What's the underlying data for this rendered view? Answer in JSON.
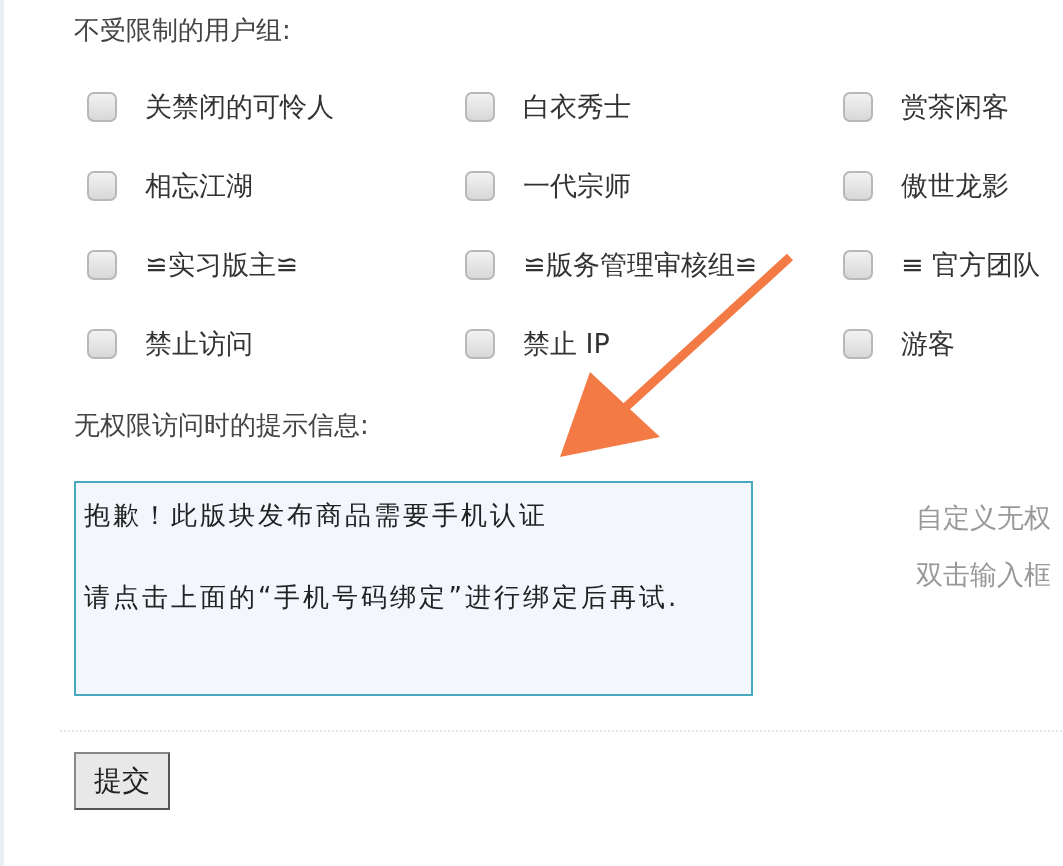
{
  "groups_section": {
    "title": "不受限制的用户组:",
    "groups": [
      {
        "label": "关禁闭的可怜人",
        "checked": false
      },
      {
        "label": "白衣秀士",
        "checked": false
      },
      {
        "label": "赏茶闲客",
        "checked": false
      },
      {
        "label": "相忘江湖",
        "checked": false
      },
      {
        "label": "一代宗师",
        "checked": false
      },
      {
        "label": "傲世龙影",
        "checked": false
      },
      {
        "label": "≌实习版主≌",
        "checked": false
      },
      {
        "label": "≌版务管理审核组≌",
        "checked": false
      },
      {
        "label": "≡ 官方团队",
        "checked": false
      },
      {
        "label": "禁止访问",
        "checked": false
      },
      {
        "label": "禁止 IP",
        "checked": false
      },
      {
        "label": "游客",
        "checked": false
      }
    ]
  },
  "message_section": {
    "title": "无权限访问时的提示信息:",
    "paragraphs": [
      "抱歉！此版块发布商品需要手机认证",
      "请点击上面的“手机号码绑定”进行绑定后再试."
    ],
    "hints": [
      "自定义无权",
      "双击输入框"
    ]
  },
  "submit": {
    "label": "提交"
  }
}
